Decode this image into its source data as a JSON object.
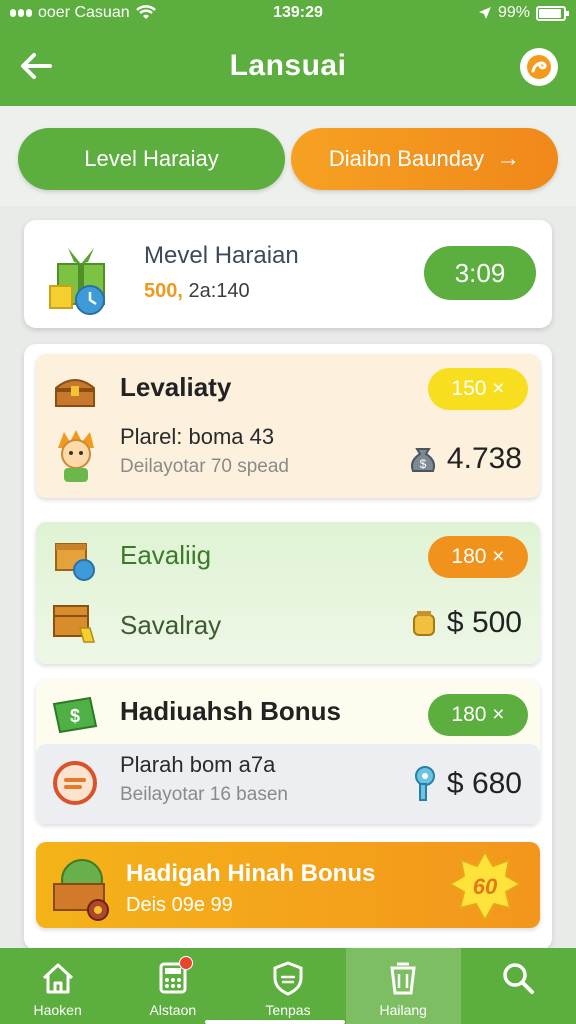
{
  "status_bar": {
    "carrier": "ooer Casuan",
    "time": "139:29",
    "battery": "99%"
  },
  "app_bar": {
    "title": "Lansuai"
  },
  "tabs": [
    {
      "label": "Level Haraiay"
    },
    {
      "label": "Diaibn Baunday"
    }
  ],
  "summary": {
    "title": "Mevel Haraian",
    "highlight": "500,",
    "sub": "2a:140",
    "timer": "3:09"
  },
  "cards": [
    {
      "title": "Levaliaty",
      "badge": "150 ×",
      "line": "Plarel: boma 43",
      "sub": "Deilayotar 70 spead",
      "amount": "4.738"
    },
    {
      "title": "Eavaliig",
      "badge": "180 ×",
      "line": "Savalray",
      "amount": "$ 500"
    },
    {
      "title": "Hadiuahsh Bonus",
      "badge": "180 ×",
      "line": "Plarah bom a7a",
      "sub": "Beilayotar 16 basen",
      "amount": "$ 680"
    }
  ],
  "banner": {
    "title": "Hadigah Hinah Bonus",
    "sub": "Deis 09e 99",
    "burst": "60"
  },
  "bottom_nav": [
    {
      "label": "Haoken"
    },
    {
      "label": "Alstaon"
    },
    {
      "label": "Tenpas"
    },
    {
      "label": "Hailang"
    },
    {
      "label": ""
    }
  ]
}
